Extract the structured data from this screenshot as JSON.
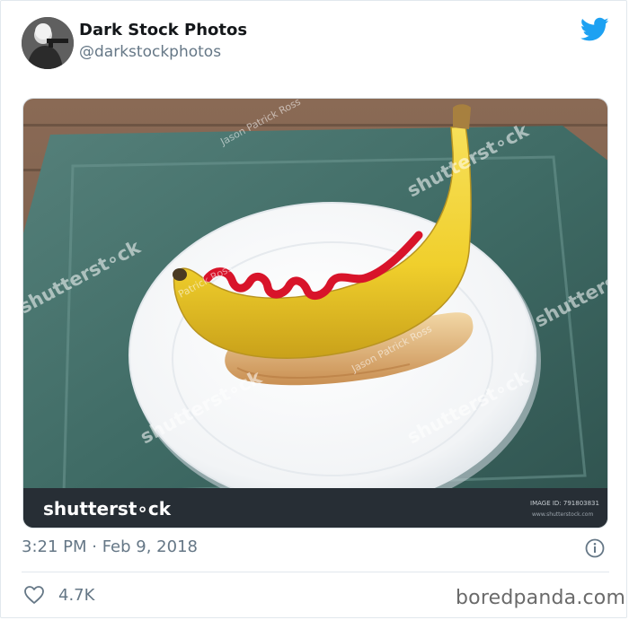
{
  "tweet": {
    "author_name": "Dark Stock Photos",
    "author_handle": "@darkstockphotos",
    "timestamp": "3:21 PM · Feb 9, 2018",
    "likes": "4.7K"
  },
  "image": {
    "brand": "shutterst∘ck",
    "watermark": "shutterst∘ck",
    "photographer_watermark": "Jason Patrick Ross",
    "photographer_watermark_short": "Patrick Ross",
    "image_id": "IMAGE ID: 791803831",
    "site": "www.shutterstock.com"
  },
  "footer": {
    "credit": "boredpanda.com"
  },
  "colors": {
    "twitter_blue": "#1da1f2",
    "muted_text": "#657786",
    "ketchup": "#d8142a",
    "banana": "#f2d23a",
    "tray": "#3f6660"
  },
  "icons": [
    "twitter-bird-icon",
    "info-icon",
    "heart-icon"
  ]
}
